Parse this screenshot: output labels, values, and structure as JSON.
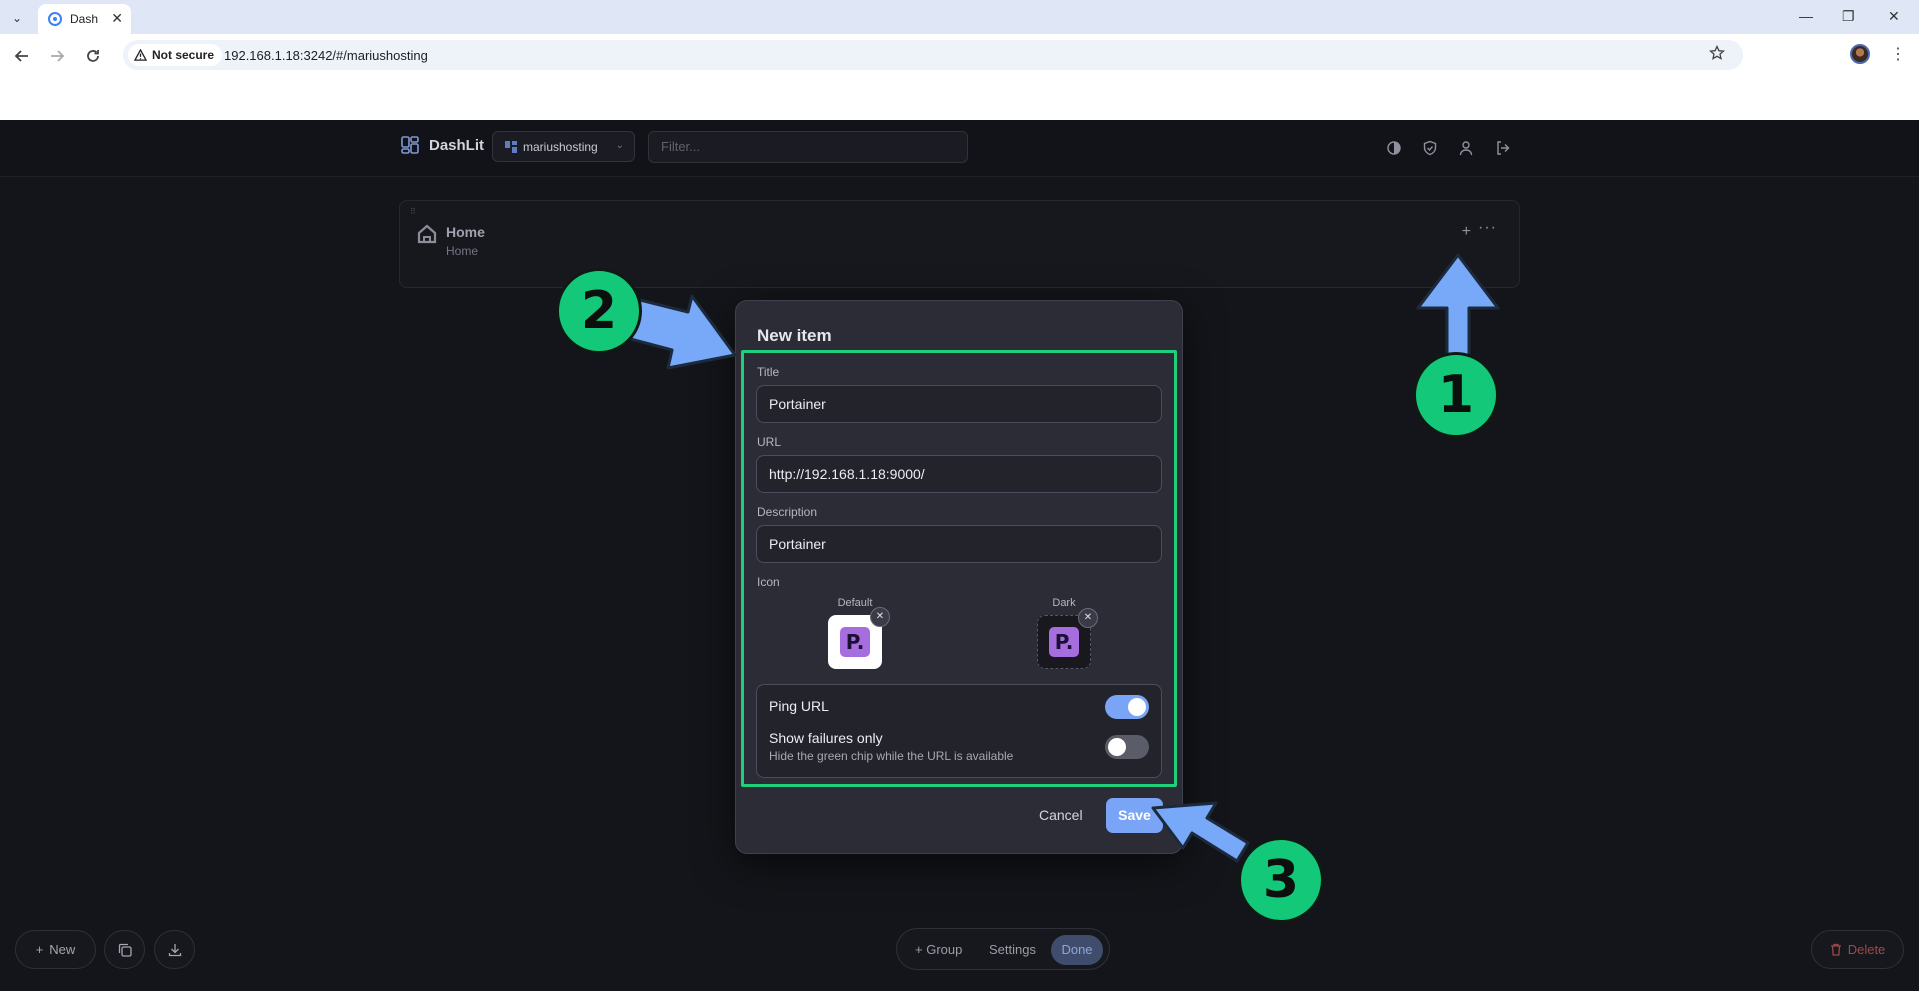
{
  "browser": {
    "tab_title": "Dash",
    "security_label": "Not secure",
    "url": "192.168.1.18:3242/#/mariushosting"
  },
  "app": {
    "brand": "DashLit",
    "dashboard_select": "mariushosting",
    "filter_placeholder": "Filter..."
  },
  "group": {
    "title": "Home",
    "subtitle": "Home"
  },
  "modal": {
    "title": "New item",
    "title_label": "Title",
    "title_value": "Portainer",
    "url_label": "URL",
    "url_value": "http://192.168.1.18:9000/",
    "description_label": "Description",
    "description_value": "Portainer",
    "icon_label": "Icon",
    "icon_default_caption": "Default",
    "icon_dark_caption": "Dark",
    "icon_glyph": "P.",
    "ping_label": "Ping URL",
    "ping_enabled": true,
    "failures_label": "Show failures only",
    "failures_help": "Hide the green chip while the URL is available",
    "failures_enabled": false,
    "cancel_label": "Cancel",
    "save_label": "Save"
  },
  "bottom": {
    "new_label": "New",
    "group_label": "+ Group",
    "settings_label": "Settings",
    "done_label": "Done",
    "delete_label": "Delete"
  },
  "annotations": {
    "step1": "1",
    "step2": "2",
    "step3": "3"
  },
  "colors": {
    "accent": "#7aa4f5",
    "annotation_green": "#13c878",
    "annotation_arrow": "#78a8f8",
    "highlight_border": "#1fcf7c"
  }
}
